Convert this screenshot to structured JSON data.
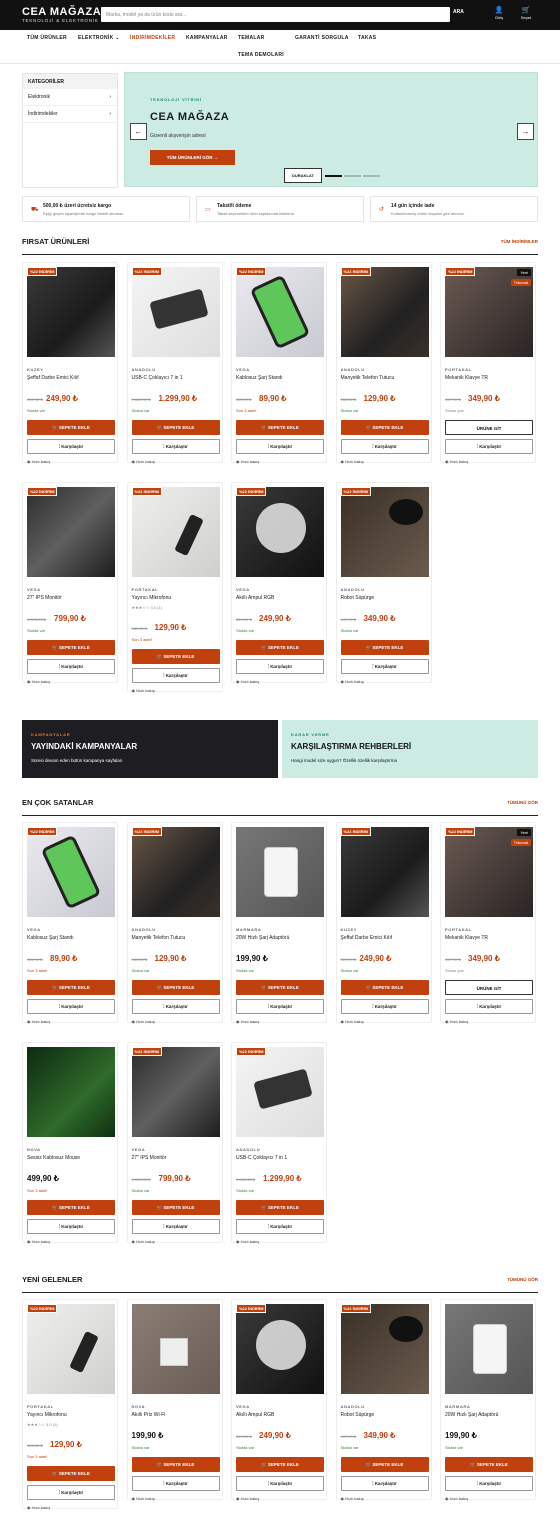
{
  "header": {
    "logo_title": "CEA MAĞAZA",
    "logo_subtitle": "TEKNOLOJİ & ELEKTRONİK",
    "search_placeholder": "Marka, model ya da ürün kodu ara...",
    "search_button": "ARA",
    "login_label": "Giriş",
    "cart_label": "Sepet"
  },
  "nav": {
    "items": [
      "TÜM ÜRÜNLER",
      "ELEKTRONİK",
      "İNDİRİMDEKİLER",
      "KAMPANYALAR",
      "TEMALAR",
      "GARANTİ SORGULA",
      "TAKAS",
      "TEMA DEMOLARI"
    ],
    "active_color": "#c0400e"
  },
  "sidebar": {
    "heading": "KATEGORİLER",
    "items": [
      "Elektronik",
      "İndirimdekiler"
    ]
  },
  "hero": {
    "eyebrow": "TEKNOLOJİ VİTRİNİ",
    "title": "CEA MAĞAZA",
    "subtitle": "Güvenli alışverişin adresi",
    "cta": "TÜM ÜRÜNLERİ GÖR →",
    "pause_label": "DURAKLAT"
  },
  "features": [
    {
      "title": "500,00 ₺ üzeri ücretsiz kargo",
      "desc": "Eşiği geçen siparişlerde kargo bedeli alınmaz."
    },
    {
      "title": "Taksitli ödeme",
      "desc": "Taksit seçenekleri ürün sayfasında listelenir."
    },
    {
      "title": "14 gün içinde iade",
      "desc": "Kullanılmamış ürünü koşuluz geri alınınız."
    }
  ],
  "common": {
    "discount_badge": "%22 İNDİRİM",
    "add_to_cart": "SEPETE EKLE",
    "go_to_product": "ÜRÜNE GİT",
    "compare": "Karşılaştır",
    "quick_view": "Hızlı bakış",
    "new_badge": "Yeni",
    "soldout_badge": "Tükendi",
    "accent": "#c0400e"
  },
  "sections": {
    "deals": {
      "title": "FIRSAT ÜRÜNLERİ",
      "link": "TÜM İNDİRİMLER",
      "products": [
        {
          "brand": "KUZEY",
          "name": "Şeffaf Darbe Emici Kılıf",
          "old": "319,90 ₺",
          "price": "249,90 ₺",
          "stock": "Stokta var"
        },
        {
          "brand": "ANADOLU",
          "name": "USB-C Çoklayıcı 7 in 1",
          "old": "1.665,90 ₺",
          "price": "1.299,90 ₺",
          "stock": "Stokta var"
        },
        {
          "brand": "VEGA",
          "name": "Kablosuz Şarj Standı",
          "old": "115,10 ₺",
          "price": "89,90 ₺",
          "stock": "Son 3 adet!"
        },
        {
          "brand": "ANADOLU",
          "name": "Manyetik Telefon Tutucu",
          "old": "166,30 ₺",
          "price": "129,90 ₺",
          "stock": "Stokta var"
        },
        {
          "brand": "PORTAKAL",
          "name": "Mekanik Klavye TR",
          "old": "447,90 ₺",
          "price": "349,90 ₺",
          "stock": "Stokta yok"
        },
        {
          "brand": "VEGA",
          "name": "27\" IPS Monitör",
          "old": "1.023,90 ₺",
          "price": "799,90 ₺",
          "stock": "Stokta var"
        },
        {
          "brand": "PORTAKAL",
          "name": "Yayıncı Mikrofonu",
          "rating": "3.0 (1)",
          "old": "166,30 ₺",
          "price": "129,90 ₺",
          "stock": "Son 3 adet!"
        },
        {
          "brand": "VEGA",
          "name": "Akıllı Ampul RGB",
          "old": "319,90 ₺",
          "price": "249,90 ₺",
          "stock": "Stokta var"
        },
        {
          "brand": "ANADOLU",
          "name": "Robot Süpürge",
          "old": "447,90 ₺",
          "price": "349,90 ₺",
          "stock": "Stokta var"
        }
      ]
    },
    "promos": [
      {
        "eyebrow": "KAMPANYALAR",
        "title": "YAYINDAKİ KAMPANYALAR",
        "desc": "Süresi devam eden bütün kampanya sayfaları"
      },
      {
        "eyebrow": "KARAR VERME",
        "title": "KARŞILAŞTIRMA REHBERLERİ",
        "desc": "Hangi model size uygun? Özellik özellik karşılaştırma"
      }
    ],
    "bestsellers": {
      "title": "EN ÇOK SATANLAR",
      "link": "TÜMÜNÜ GÖR",
      "products": [
        {
          "brand": "VEGA",
          "name": "Kablosuz Şarj Standı",
          "old": "115,10 ₺",
          "price": "89,90 ₺",
          "stock": "Son 3 adet!"
        },
        {
          "brand": "ANADOLU",
          "name": "Manyetik Telefon Tutucu",
          "old": "166,30 ₺",
          "price": "129,90 ₺",
          "stock": "Stokta var"
        },
        {
          "brand": "MARMARA",
          "name": "20W Hızlı Şarj Adaptörü",
          "price": "199,90 ₺",
          "stock": "Stokta var"
        },
        {
          "brand": "KUZEY",
          "name": "Şeffaf Darbe Emici Kılıf",
          "old": "319,90 ₺",
          "price": "249,90 ₺",
          "stock": "Stokta var"
        },
        {
          "brand": "PORTAKAL",
          "name": "Mekanik Klavye TR",
          "old": "447,90 ₺",
          "price": "349,90 ₺",
          "stock": "Stokta yok"
        },
        {
          "brand": "NOVA",
          "name": "Sessiz Kablosuz Mouse",
          "price": "499,90 ₺",
          "stock": "Son 3 adet!"
        },
        {
          "brand": "VEGA",
          "name": "27\" IPS Monitör",
          "old": "1.023,90 ₺",
          "price": "799,90 ₺",
          "stock": "Stokta var"
        },
        {
          "brand": "ANADOLU",
          "name": "USB-C Çoklayıcı 7 in 1",
          "old": "1.665,90 ₺",
          "price": "1.299,90 ₺",
          "stock": "Stokta var"
        }
      ]
    },
    "newarrivals": {
      "title": "YENİ GELENLER",
      "link": "TÜMÜNÜ GÖR",
      "products": [
        {
          "brand": "PORTAKAL",
          "name": "Yayıncı Mikrofonu",
          "rating": "3.0 (1)",
          "old": "166,30 ₺",
          "price": "129,90 ₺",
          "stock": "Son 3 adet!"
        },
        {
          "brand": "NOVA",
          "name": "Akıllı Priz Wi-Fi",
          "price": "199,90 ₺",
          "stock": "Stokta var"
        },
        {
          "brand": "VEGA",
          "name": "Akıllı Ampul RGB",
          "old": "319,90 ₺",
          "price": "249,90 ₺",
          "stock": "Stokta var"
        },
        {
          "brand": "ANADOLU",
          "name": "Robot Süpürge",
          "old": "447,90 ₺",
          "price": "349,90 ₺",
          "stock": "Stokta var"
        },
        {
          "brand": "MARMARA",
          "name": "20W Hızlı Şarj Adaptörü",
          "price": "199,90 ₺",
          "stock": "Stokta var"
        }
      ]
    }
  }
}
